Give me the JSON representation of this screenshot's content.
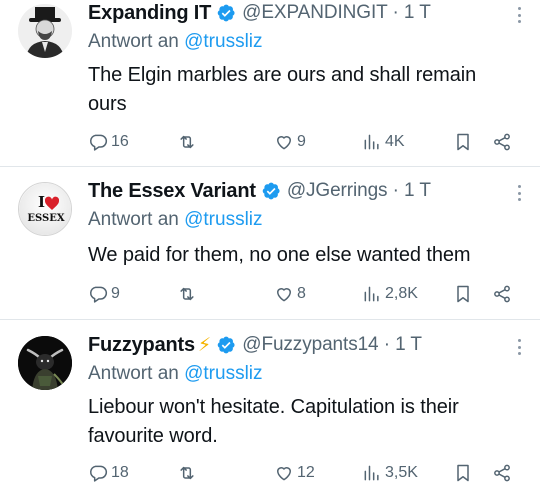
{
  "tweets": [
    {
      "name": "Expanding IT",
      "verified": true,
      "lightning": false,
      "meta": "@EXPANDINGIT · 1 T",
      "reply_prefix": "Antwort an",
      "reply_handle": "@trussliz",
      "text": "The Elgin marbles are ours and shall remain ours",
      "replies": "16",
      "retweets": "",
      "likes": "9",
      "views": "4K",
      "avatar": "man-with-top-hat-portrait"
    },
    {
      "name": "The Essex Variant",
      "verified": true,
      "lightning": false,
      "meta": "@JGerrings · 1 T",
      "reply_prefix": "Antwort an",
      "reply_handle": "@trussliz",
      "text": "We paid for them, no one else wanted them",
      "replies": "9",
      "retweets": "",
      "likes": "8",
      "views": "2,8K",
      "avatar_badge_top": "I",
      "avatar_badge_bottom": "ESSEX"
    },
    {
      "name": "Fuzzypants",
      "verified": true,
      "lightning": true,
      "lightning_glyph": "⚡",
      "meta": "@Fuzzypants14 · 1 T",
      "reply_prefix": "Antwort an",
      "reply_handle": "@trussliz",
      "text": "Liebour won't hesitate. Capitulation is their favourite word.",
      "replies": "18",
      "retweets": "",
      "likes": "12",
      "views": "3,5K",
      "avatar": "dark-bull-figure"
    }
  ],
  "colors": {
    "verified": "#1d9bf0",
    "link": "#1d9bf0",
    "secondary": "#536471",
    "lightning": "#f5b400",
    "heart": "#d9202a"
  }
}
